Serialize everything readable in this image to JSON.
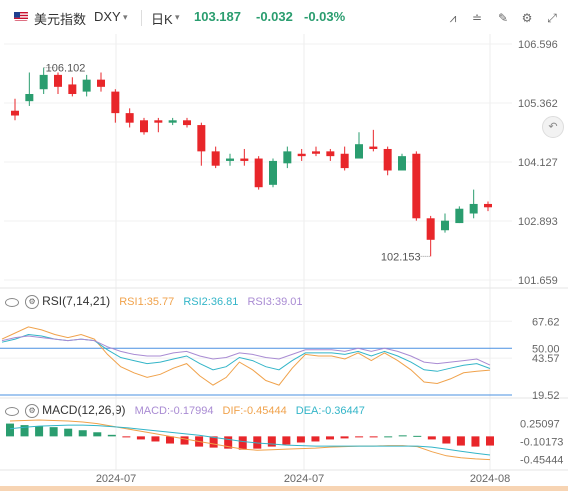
{
  "header": {
    "name": "美元指数",
    "symbol": "DXY",
    "period": "日K",
    "price": "103.187",
    "change": "-0.032",
    "change_pct": "-0.03%"
  },
  "colors": {
    "up": "#2a9d6f",
    "down": "#e8262a",
    "rsi1": "#f0a24b",
    "rsi2": "#33b5c8",
    "rsi3": "#a98bd3",
    "dif": "#f0a24b",
    "dea": "#33b5c8"
  },
  "rsi_panel": {
    "name": "RSI(7,14,21)",
    "rsi1": "RSI1:35.77",
    "rsi2": "RSI2:36.81",
    "rsi3": "RSI3:39.01"
  },
  "macd_panel": {
    "name": "MACD(12,26,9)",
    "macd": "MACD:-0.17994",
    "dif": "DIF:-0.45444",
    "dea": "DEA:-0.36447"
  },
  "chart_data": [
    {
      "type": "candlestick",
      "title": "美元指数 DXY 日K",
      "x_labels": [
        "2024-07",
        "2024-07",
        "2024-08"
      ],
      "y_ticks": [
        106.596,
        105.362,
        104.127,
        102.893,
        101.659
      ],
      "ylim": [
        101.659,
        106.596
      ],
      "annotations": [
        {
          "text": "106.102",
          "type": "high"
        },
        {
          "text": "102.153",
          "type": "low"
        }
      ],
      "candles": [
        {
          "o": 105.2,
          "c": 105.1,
          "h": 105.45,
          "l": 105.0
        },
        {
          "o": 105.4,
          "c": 105.55,
          "h": 106.0,
          "l": 105.3
        },
        {
          "o": 105.65,
          "c": 105.95,
          "h": 106.102,
          "l": 105.55
        },
        {
          "o": 105.95,
          "c": 105.7,
          "h": 106.0,
          "l": 105.55
        },
        {
          "o": 105.75,
          "c": 105.55,
          "h": 105.9,
          "l": 105.5
        },
        {
          "o": 105.6,
          "c": 105.85,
          "h": 105.95,
          "l": 105.5
        },
        {
          "o": 105.85,
          "c": 105.7,
          "h": 106.0,
          "l": 105.6
        },
        {
          "o": 105.6,
          "c": 105.15,
          "h": 105.65,
          "l": 104.95
        },
        {
          "o": 105.15,
          "c": 104.95,
          "h": 105.25,
          "l": 104.85
        },
        {
          "o": 105.0,
          "c": 104.75,
          "h": 105.05,
          "l": 104.7
        },
        {
          "o": 105.0,
          "c": 104.95,
          "h": 105.05,
          "l": 104.75
        },
        {
          "o": 104.95,
          "c": 105.0,
          "h": 105.05,
          "l": 104.9
        },
        {
          "o": 105.0,
          "c": 104.9,
          "h": 105.05,
          "l": 104.85
        },
        {
          "o": 104.9,
          "c": 104.35,
          "h": 104.95,
          "l": 104.05
        },
        {
          "o": 104.35,
          "c": 104.05,
          "h": 104.45,
          "l": 104.0
        },
        {
          "o": 104.15,
          "c": 104.2,
          "h": 104.3,
          "l": 104.05
        },
        {
          "o": 104.2,
          "c": 104.15,
          "h": 104.4,
          "l": 104.05
        },
        {
          "o": 104.2,
          "c": 103.6,
          "h": 104.25,
          "l": 103.55
        },
        {
          "o": 103.65,
          "c": 104.15,
          "h": 104.2,
          "l": 103.6
        },
        {
          "o": 104.1,
          "c": 104.35,
          "h": 104.45,
          "l": 104.0
        },
        {
          "o": 104.3,
          "c": 104.25,
          "h": 104.4,
          "l": 104.15
        },
        {
          "o": 104.35,
          "c": 104.3,
          "h": 104.45,
          "l": 104.25
        },
        {
          "o": 104.35,
          "c": 104.25,
          "h": 104.4,
          "l": 104.15
        },
        {
          "o": 104.3,
          "c": 104.0,
          "h": 104.45,
          "l": 103.95
        },
        {
          "o": 104.2,
          "c": 104.5,
          "h": 104.75,
          "l": 104.2
        },
        {
          "o": 104.45,
          "c": 104.4,
          "h": 104.8,
          "l": 104.35
        },
        {
          "o": 104.4,
          "c": 103.95,
          "h": 104.45,
          "l": 103.85
        },
        {
          "o": 103.95,
          "c": 104.25,
          "h": 104.3,
          "l": 103.95
        },
        {
          "o": 104.3,
          "c": 102.95,
          "h": 104.35,
          "l": 102.9
        },
        {
          "o": 102.95,
          "c": 102.5,
          "h": 103.0,
          "l": 102.153
        },
        {
          "o": 102.7,
          "c": 102.9,
          "h": 103.05,
          "l": 102.65
        },
        {
          "o": 102.85,
          "c": 103.15,
          "h": 103.2,
          "l": 102.85
        },
        {
          "o": 103.05,
          "c": 103.25,
          "h": 103.55,
          "l": 102.95
        },
        {
          "o": 103.25,
          "c": 103.18,
          "h": 103.3,
          "l": 103.1
        }
      ]
    },
    {
      "type": "line",
      "title": "RSI(7,14,21)",
      "y_ticks": [
        67.62,
        50.0,
        43.57,
        19.52
      ],
      "ylim": [
        19.52,
        75
      ],
      "series": [
        {
          "name": "RSI1",
          "values": [
            56,
            60,
            64,
            62,
            59,
            57,
            59,
            56,
            46,
            38,
            34,
            31,
            33,
            37,
            40,
            32,
            26,
            31,
            41,
            36,
            29,
            26,
            37,
            46,
            45,
            45,
            43,
            47,
            42,
            47,
            42,
            36,
            28,
            27,
            30,
            34,
            35,
            35.77
          ]
        },
        {
          "name": "RSI2",
          "values": [
            54,
            56,
            59,
            58,
            56,
            55,
            56,
            55,
            49,
            44,
            42,
            40,
            41,
            43,
            45,
            40,
            36,
            38,
            44,
            42,
            38,
            36,
            42,
            47,
            47,
            47,
            46,
            48,
            45,
            48,
            45,
            41,
            36,
            35,
            37,
            39,
            40,
            36.81
          ]
        },
        {
          "name": "RSI3",
          "values": [
            55,
            57,
            58,
            57,
            56,
            55,
            56,
            55,
            51,
            48,
            46,
            45,
            45,
            47,
            48,
            45,
            43,
            44,
            47,
            46,
            44,
            43,
            46,
            49,
            49,
            49,
            48,
            50,
            48,
            50,
            48,
            45,
            41,
            40,
            41,
            42,
            43,
            39.01
          ]
        }
      ]
    },
    {
      "type": "bar",
      "title": "MACD(12,26,9)",
      "y_ticks": [
        0.25097,
        -0.10173,
        -0.45444
      ],
      "ylim": [
        -0.56,
        0.32
      ],
      "series": [
        {
          "name": "MACD",
          "values": [
            0.25,
            0.22,
            0.2,
            0.18,
            0.15,
            0.12,
            0.08,
            0.03,
            -0.02,
            -0.06,
            -0.1,
            -0.14,
            -0.16,
            -0.2,
            -0.22,
            -0.24,
            -0.26,
            -0.24,
            -0.2,
            -0.16,
            -0.12,
            -0.1,
            -0.06,
            -0.04,
            -0.02,
            -0.02,
            0.0,
            0.02,
            0.01,
            -0.06,
            -0.14,
            -0.18,
            -0.2,
            -0.17994
          ]
        },
        {
          "name": "DIF",
          "values": [
            0.3,
            0.31,
            0.32,
            0.31,
            0.3,
            0.28,
            0.25,
            0.2,
            0.15,
            0.1,
            0.05,
            0.0,
            -0.05,
            -0.1,
            -0.15,
            -0.2,
            -0.25,
            -0.27,
            -0.26,
            -0.25,
            -0.24,
            -0.23,
            -0.21,
            -0.2,
            -0.19,
            -0.19,
            -0.18,
            -0.18,
            -0.2,
            -0.3,
            -0.38,
            -0.42,
            -0.44,
            -0.45444
          ]
        },
        {
          "name": "DEA",
          "values": [
            0.15,
            0.18,
            0.2,
            0.21,
            0.22,
            0.22,
            0.21,
            0.19,
            0.17,
            0.14,
            0.11,
            0.08,
            0.05,
            0.02,
            -0.02,
            -0.06,
            -0.1,
            -0.13,
            -0.15,
            -0.17,
            -0.18,
            -0.19,
            -0.19,
            -0.19,
            -0.19,
            -0.19,
            -0.19,
            -0.19,
            -0.19,
            -0.21,
            -0.25,
            -0.29,
            -0.33,
            -0.36447
          ]
        }
      ]
    }
  ]
}
